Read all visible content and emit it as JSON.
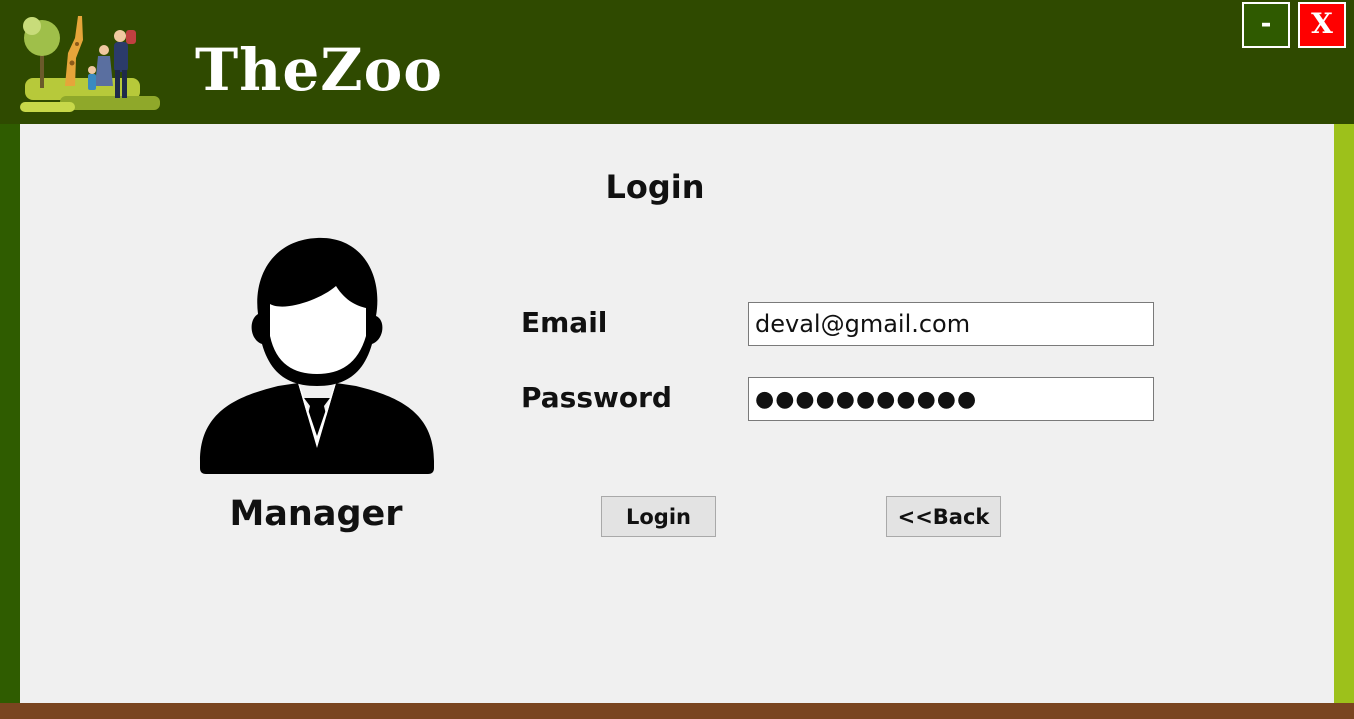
{
  "app": {
    "brand": "TheZoo"
  },
  "window_controls": {
    "minimize_label": "-",
    "close_label": "X"
  },
  "form": {
    "title": "Login",
    "role": "Manager",
    "email_label": "Email",
    "email_value": "deval@gmail.com",
    "password_label": "Password",
    "password_value": "●●●●●●●●●●●",
    "login_button": "Login",
    "back_button": "<<Back"
  },
  "icons": {
    "logo": "zoo-family-giraffe-logo",
    "avatar": "manager-avatar-icon"
  },
  "colors": {
    "header": "#2f4a00",
    "left_border": "#2f5c00",
    "right_border": "#9dc11b",
    "footer": "#7a4520",
    "close": "#ff0000",
    "background": "#f0f0f0"
  }
}
